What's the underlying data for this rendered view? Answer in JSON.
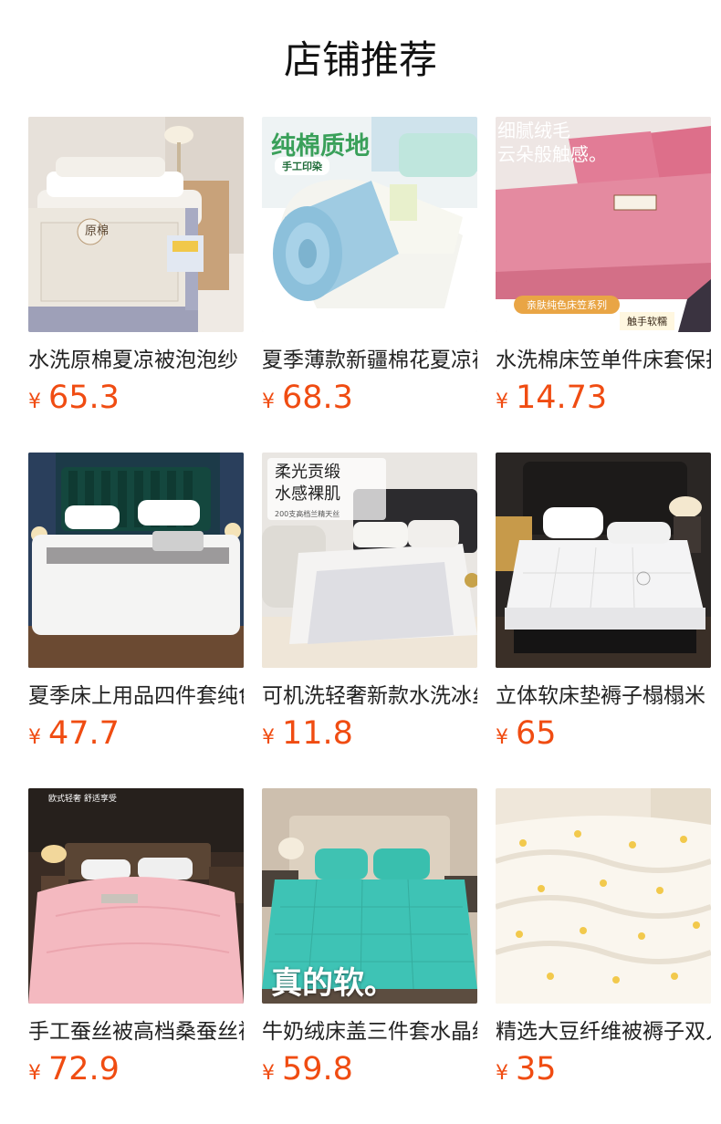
{
  "header": {
    "title": "店铺推荐"
  },
  "currency": "¥",
  "products": [
    {
      "title": "水洗原棉夏凉被泡泡纱",
      "price": "65.3",
      "image_overlay": {
        "line1": "原棉",
        "line2": ""
      }
    },
    {
      "title": "夏季薄款新疆棉花夏凉被",
      "price": "68.3",
      "image_overlay": {
        "line1": "纯棉质地",
        "line2": "手工印染"
      }
    },
    {
      "title": "水洗棉床笠单件床套保护罩",
      "price": "14.73",
      "image_overlay": {
        "line1": "细腻绒毛",
        "line2": "云朵般触感。",
        "badge": "亲肤纯色床笠系列",
        "tag": "触手软糯"
      }
    },
    {
      "title": "夏季床上用品四件套纯色",
      "price": "47.7",
      "image_overlay": {}
    },
    {
      "title": "可机洗轻奢新款水洗冰丝",
      "price": "11.8",
      "image_overlay": {
        "line1": "柔光贡缎",
        "line2": "水感裸肌",
        "sub": "200支高档兰精天丝"
      }
    },
    {
      "title": "立体软床垫褥子榻榻米",
      "price": "65",
      "image_overlay": {}
    },
    {
      "title": "手工蚕丝被高档桑蚕丝被",
      "price": "72.9",
      "image_overlay": {
        "line1": "欧式轻奢 舒适享受"
      }
    },
    {
      "title": "牛奶绒床盖三件套水晶绒",
      "price": "59.8",
      "image_overlay": {
        "line1": "真的软。"
      }
    },
    {
      "title": "精选大豆纤维被褥子双人",
      "price": "35",
      "image_overlay": {}
    }
  ]
}
